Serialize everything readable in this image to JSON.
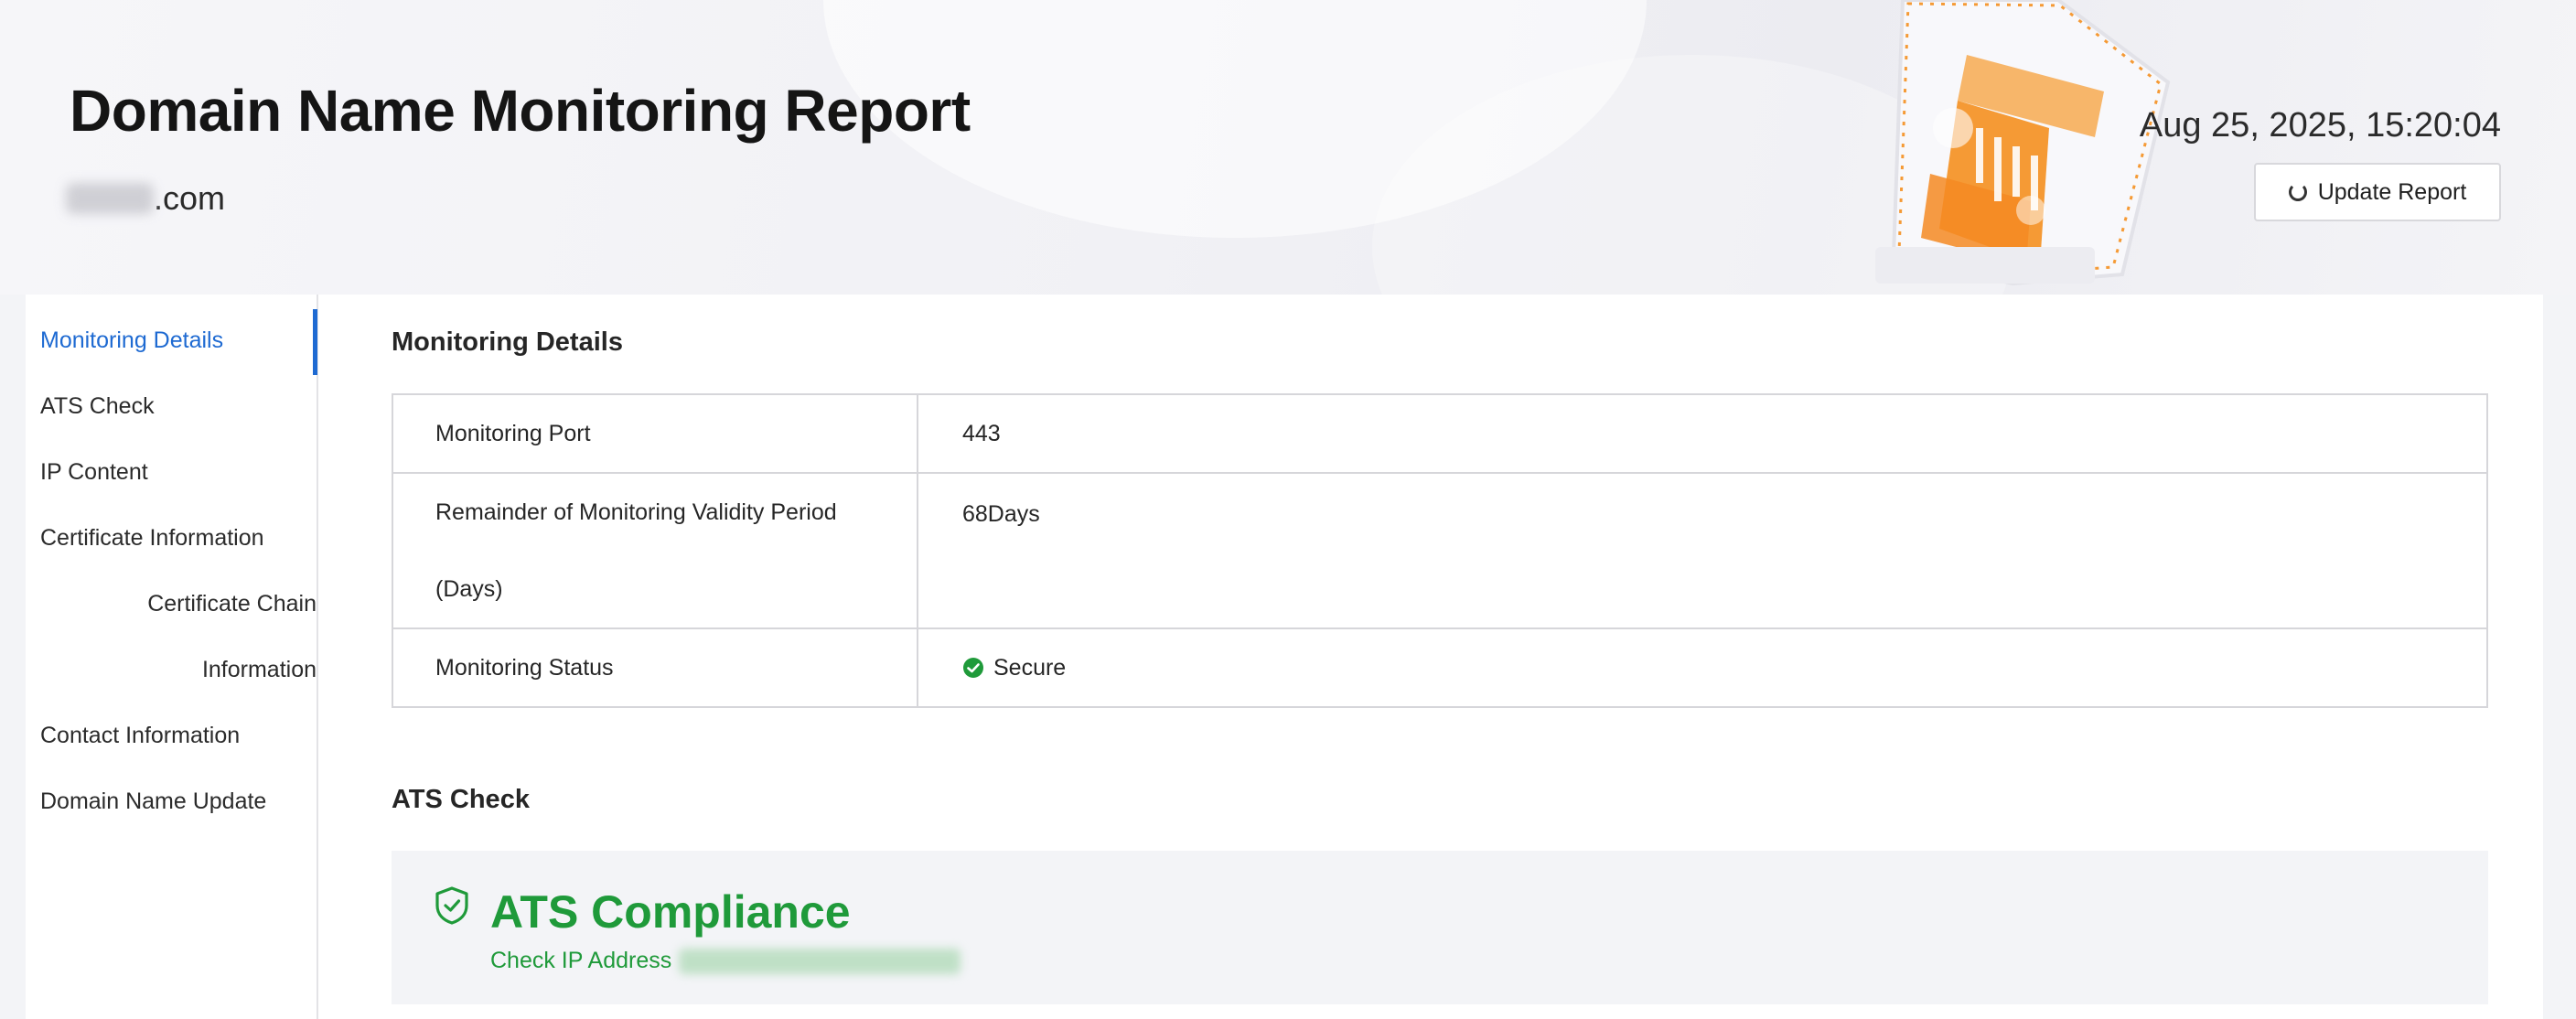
{
  "header": {
    "title": "Domain Name Monitoring Report",
    "domain_suffix": ".com",
    "timestamp": "Aug 25, 2025, 15:20:04",
    "update_button_label": "Update Report"
  },
  "sidebar": {
    "items": [
      {
        "label": "Monitoring Details",
        "active": true
      },
      {
        "label": "ATS Check"
      },
      {
        "label": "IP Content"
      },
      {
        "label": "Certificate Information"
      },
      {
        "label": "Certificate Chain"
      },
      {
        "label": "Information"
      },
      {
        "label": "Contact Information"
      },
      {
        "label": "Domain Name Update"
      }
    ]
  },
  "monitoring": {
    "section_title": "Monitoring Details",
    "rows": [
      {
        "label": "Monitoring Port",
        "value": "443"
      },
      {
        "label_line1": "Remainder of Monitoring Validity Period",
        "label_line2": "(Days)",
        "value": "68Days"
      },
      {
        "label": "Monitoring Status",
        "value": "Secure"
      }
    ]
  },
  "ats": {
    "section_title": "ATS Check",
    "status_title": "ATS Compliance",
    "check_ip_label": "Check IP Address"
  },
  "colors": {
    "accent_blue": "#1e6ad2",
    "success_green": "#1f9a3a",
    "illustration_orange": "#f59a35"
  }
}
